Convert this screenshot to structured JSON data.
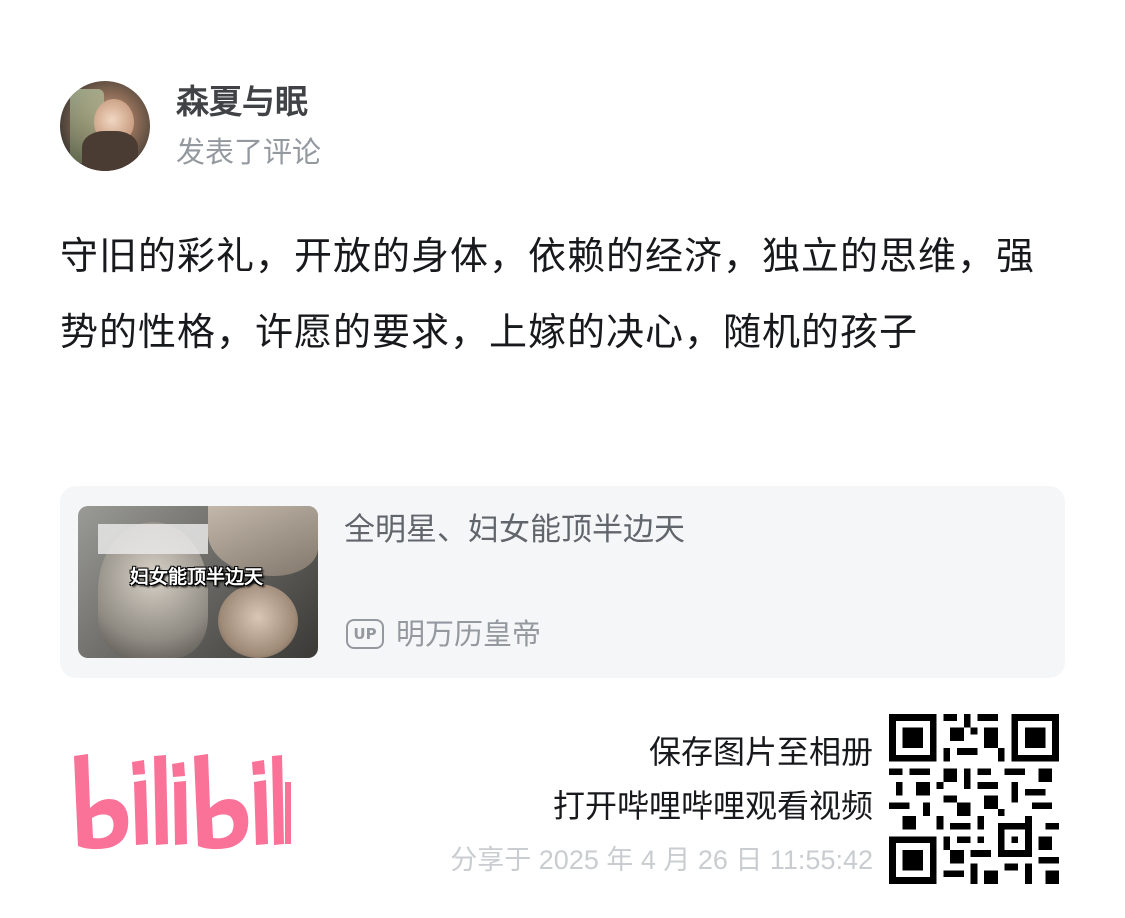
{
  "post": {
    "user_name": "森夏与眠",
    "action": "发表了评论",
    "comment": "守旧的彩礼，开放的身体，依赖的经济，独立的思维，强势的性格，许愿的要求，上嫁的决心，随机的孩子"
  },
  "video": {
    "thumbnail_caption": "妇女能顶半边天",
    "title": "全明星、妇女能顶半边天",
    "up_badge": "UP",
    "uploader": "明万历皇帝"
  },
  "footer": {
    "logo_text": "bilibili",
    "logo_color": "#fb7299",
    "line1": "保存图片至相册",
    "line2": "打开哔哩哔哩观看视频",
    "share_time": "分享于 2025 年 4 月 26 日 11:55:42"
  }
}
